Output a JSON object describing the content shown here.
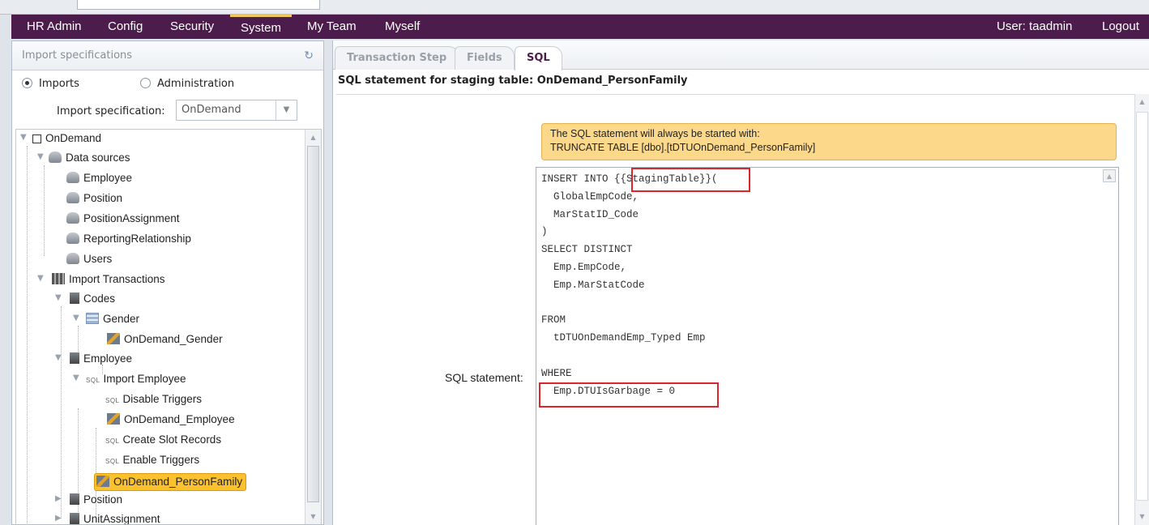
{
  "nav": {
    "items": [
      "HR Admin",
      "Config",
      "Security",
      "System",
      "My Team",
      "Myself"
    ],
    "active": "System",
    "user": "User: taadmin",
    "logout": "Logout"
  },
  "left": {
    "header": "Import specifications",
    "radio_imports": "Imports",
    "radio_admin": "Administration",
    "spec_label": "Import specification:",
    "spec_value": "OnDemand",
    "tree": [
      {
        "label": "OnDemand"
      },
      {
        "label": "Data sources"
      },
      {
        "label": "Employee"
      },
      {
        "label": "Position"
      },
      {
        "label": "PositionAssignment"
      },
      {
        "label": "ReportingRelationship"
      },
      {
        "label": "Users"
      },
      {
        "label": "Import Transactions"
      },
      {
        "label": "Codes"
      },
      {
        "label": "Gender"
      },
      {
        "label": "OnDemand_Gender"
      },
      {
        "label": "Employee"
      },
      {
        "label": "Import Employee"
      },
      {
        "label": "Disable Triggers"
      },
      {
        "label": "OnDemand_Employee"
      },
      {
        "label": "Create Slot Records"
      },
      {
        "label": "Enable Triggers"
      },
      {
        "label": "OnDemand_PersonFamily"
      },
      {
        "label": "Position"
      },
      {
        "label": "UnitAssignment"
      }
    ],
    "sql_tag": "SQL"
  },
  "right": {
    "tabs": [
      "Transaction Step",
      "Fields",
      "SQL"
    ],
    "active_tab": "SQL",
    "stmt_title": "SQL statement for staging table: OnDemand_PersonFamily",
    "info_line1": "The SQL statement will always be started with:",
    "info_line2": "TRUNCATE TABLE [dbo].[tDTUOnDemand_PersonFamily]",
    "sql_label": "SQL statement:",
    "sql_lines": [
      "INSERT INTO {{StagingTable}}(",
      "  GlobalEmpCode,",
      "  MarStatID_Code",
      ")",
      "SELECT DISTINCT",
      "  Emp.EmpCode,",
      "  Emp.MarStatCode",
      "",
      "FROM",
      "  tDTUOnDemandEmp_Typed Emp",
      "",
      "WHERE",
      "  Emp.DTUIsGarbage = 0"
    ]
  },
  "colors": {
    "nav_bg": "#4c1c4c",
    "nav_active": "#f0c75c",
    "selected_node": "#fbc12f",
    "info_bg": "#fbd88a",
    "highlight": "#e0242e"
  }
}
